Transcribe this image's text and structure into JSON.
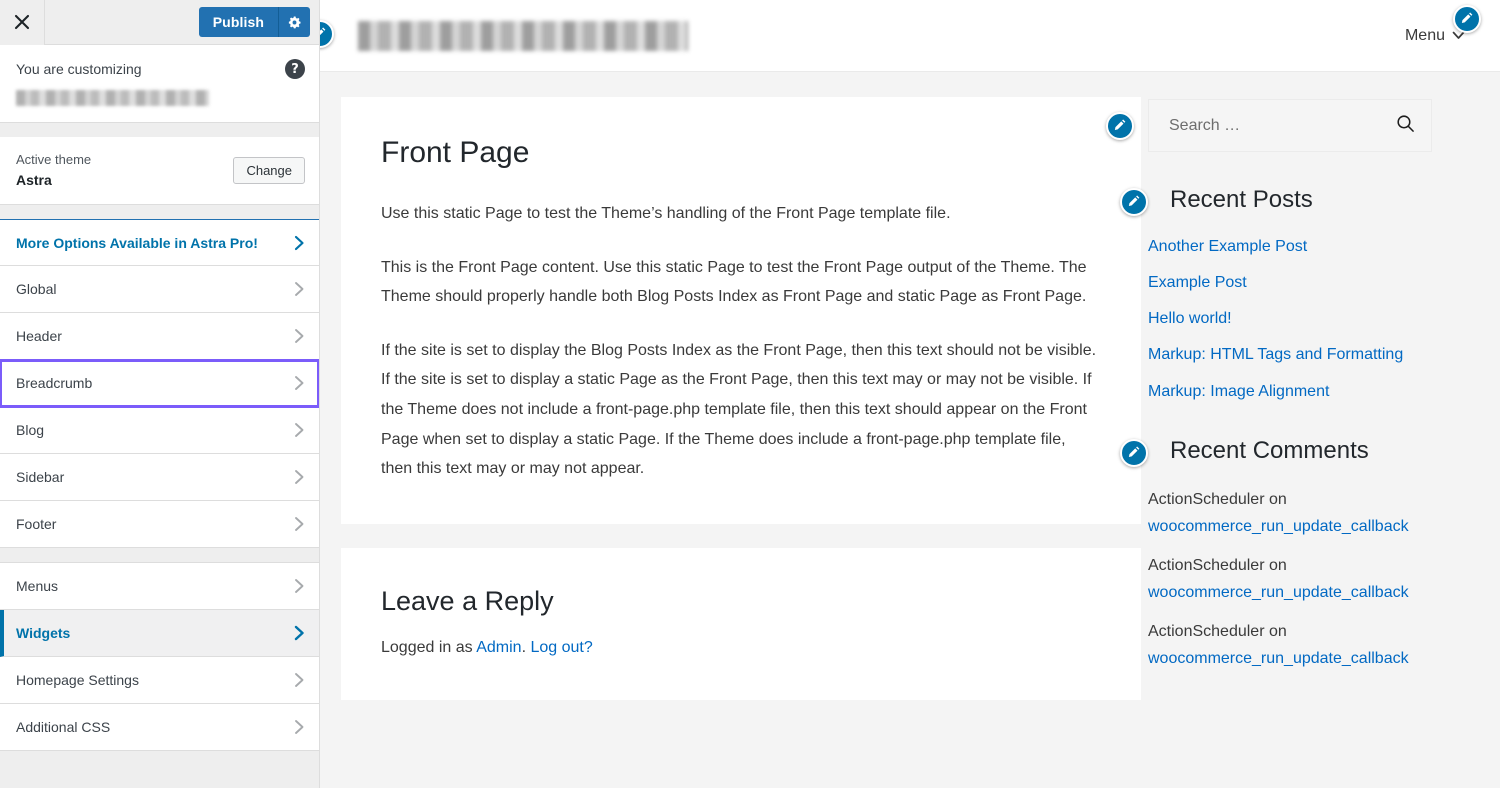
{
  "customizer": {
    "close_label": "Close customizer",
    "publish_label": "Publish",
    "gear_label": "Publish settings",
    "info_title": "You are customizing",
    "help_label": "?",
    "site_name_redacted": "",
    "active_theme_label": "Active theme",
    "active_theme_name": "Astra",
    "change_label": "Change",
    "panels": [
      {
        "label": "More Options Available in Astra Pro!",
        "state": "promo"
      },
      {
        "label": "Global",
        "state": "normal"
      },
      {
        "label": "Header",
        "state": "normal"
      },
      {
        "label": "Breadcrumb",
        "state": "focused"
      },
      {
        "label": "Blog",
        "state": "normal"
      },
      {
        "label": "Sidebar",
        "state": "normal"
      },
      {
        "label": "Footer",
        "state": "normal"
      }
    ],
    "panels_group2": [
      {
        "label": "Menus",
        "state": "normal"
      },
      {
        "label": "Widgets",
        "state": "active"
      },
      {
        "label": "Homepage Settings",
        "state": "normal"
      },
      {
        "label": "Additional CSS",
        "state": "normal"
      }
    ],
    "accent_color": "#2271b1",
    "focus_outline_color": "#7b5cfa",
    "active_color": "#0073aa"
  },
  "preview": {
    "header": {
      "site_title_redacted": "",
      "menu_label": "Menu"
    },
    "front_page": {
      "title": "Front Page",
      "paragraphs": [
        "Use this static Page to test the Theme’s handling of the Front Page template file.",
        "This is the Front Page content. Use this static Page to test the Front Page output of the Theme. The Theme should properly handle both Blog Posts Index as Front Page and static Page as Front Page.",
        "If the site is set to display the Blog Posts Index as the Front Page, then this text should not be visible. If the site is set to display a static Page as the Front Page, then this text may or may not be visible. If the Theme does not include a front-page.php template file, then this text should appear on the Front Page when set to display a static Page. If the Theme does include a front-page.php template file, then this text may or may not appear."
      ]
    },
    "comments": {
      "title": "Leave a Reply",
      "logged_in_prefix": "Logged in as ",
      "logged_in_user": "Admin",
      "logged_in_separator": ". ",
      "logout_label": "Log out?"
    },
    "sidebar": {
      "search": {
        "placeholder": "Search …",
        "value": "",
        "icon": "search-icon"
      },
      "recent_posts": {
        "title": "Recent Posts",
        "items": [
          "Another Example Post",
          "Example Post",
          "Hello world!",
          "Markup: HTML Tags and Formatting",
          "Markup: Image Alignment"
        ]
      },
      "recent_comments": {
        "title": "Recent Comments",
        "items": [
          {
            "author": "ActionScheduler on",
            "link": "woocommerce_run_update_callback"
          },
          {
            "author": "ActionScheduler on",
            "link": "woocommerce_run_update_callback"
          },
          {
            "author": "ActionScheduler on",
            "link": "woocommerce_run_update_callback"
          }
        ]
      }
    },
    "link_color": "#0269c3",
    "edit_shortcut_color": "#0073aa"
  }
}
